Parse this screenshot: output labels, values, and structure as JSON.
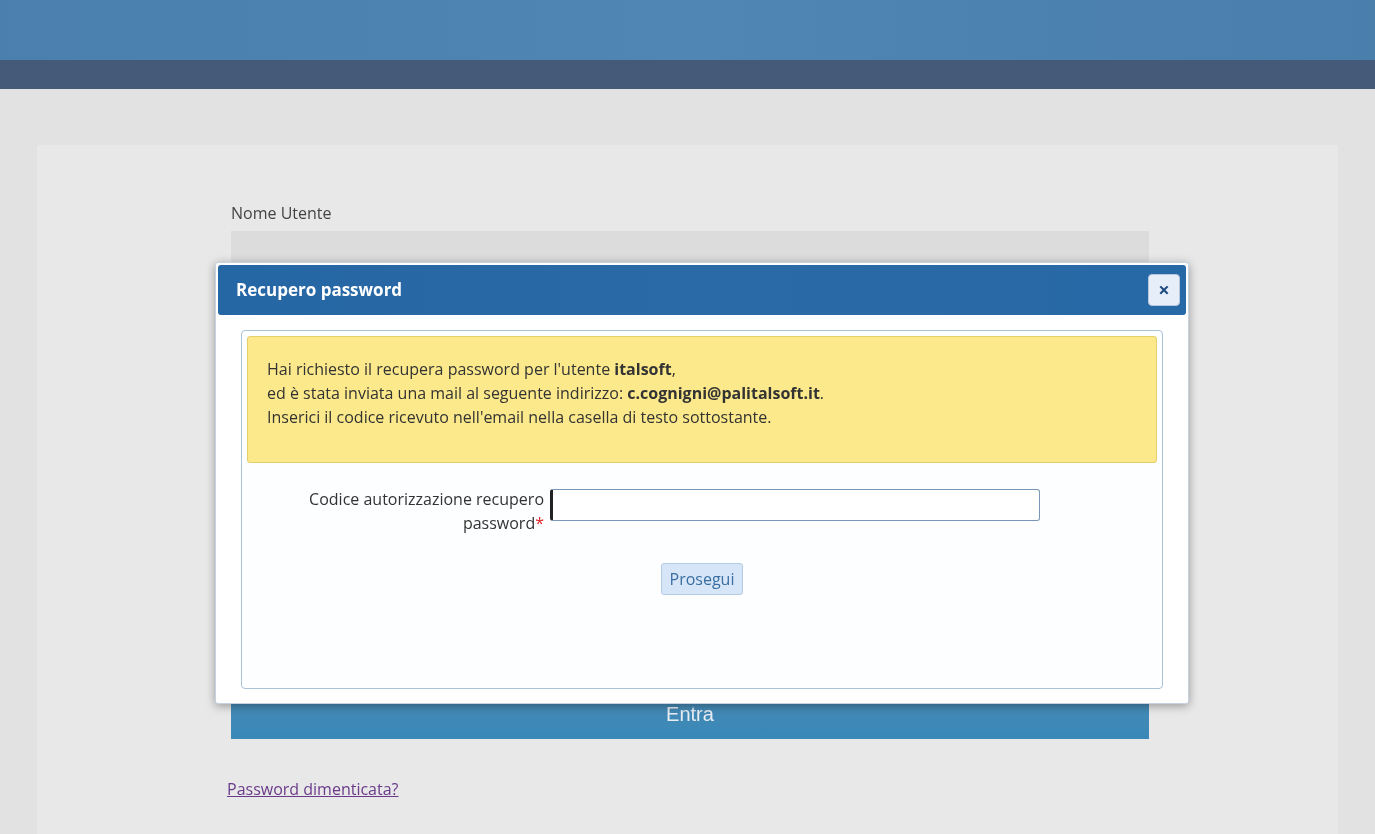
{
  "login_form": {
    "username_label": "Nome Utente",
    "submit_button": "Entra",
    "forgot_link": "Password dimenticata?"
  },
  "dialog": {
    "title": "Recupero password",
    "close_icon": "×",
    "message_lines": [
      "Hai richiesto il recupera password per l'utente **italsoft**,",
      "ed è stata inviata una mail al seguente indirizzo: **c.cognigni@palitalsoft.it**.",
      "Inserici il codice ricevuto nell'email nella casella di testo sottostante."
    ],
    "code_field": {
      "label": "Codice autorizzazione recupero password",
      "required_mark": "*",
      "focused": true
    },
    "continue_button": "Prosegui"
  }
}
